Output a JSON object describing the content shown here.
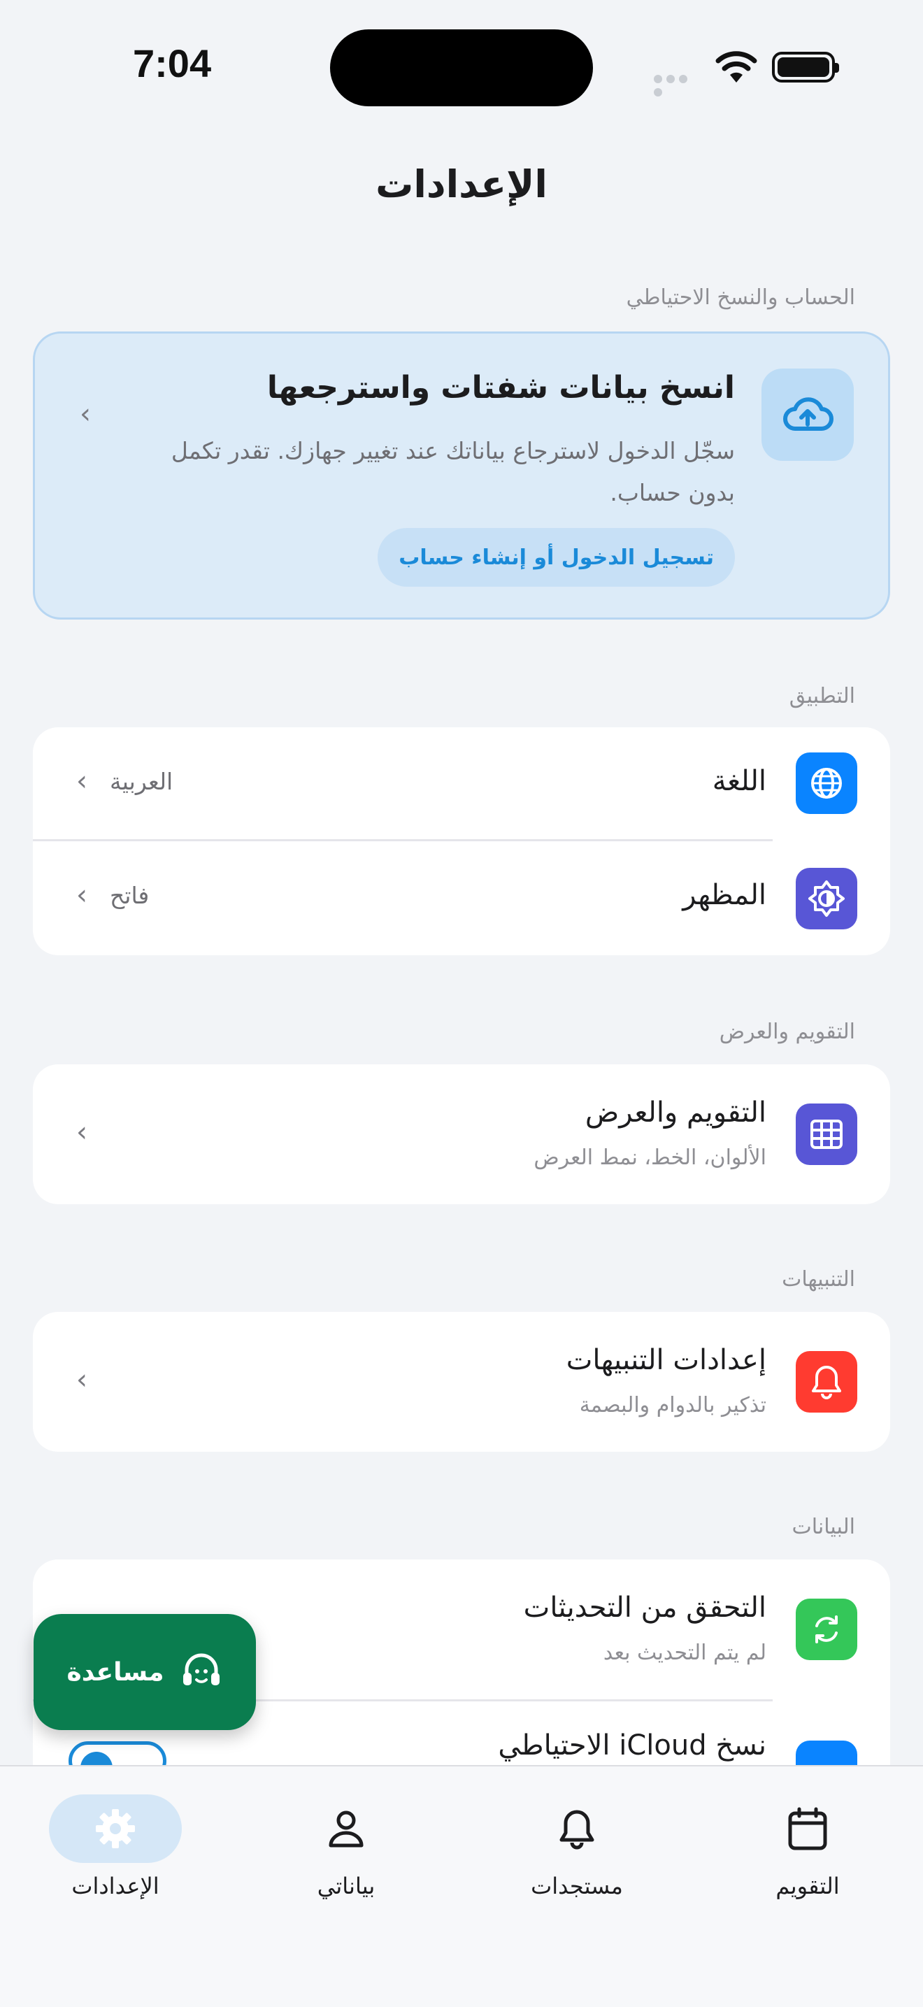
{
  "status_bar": {
    "time": "7:04"
  },
  "page": {
    "title": "الإعدادات"
  },
  "sections": {
    "account": "الحساب والنسخ الاحتياطي",
    "app": "التطبيق",
    "calendar": "التقويم والعرض",
    "notifications": "التنبيهات",
    "data": "البيانات"
  },
  "backup_card": {
    "title": "انسخ بيانات شفتات واسترجعها",
    "description": "سجّل الدخول لاسترجاع بياناتك عند تغيير جهازك. تقدر تكمل بدون حساب.",
    "button_label": "تسجيل الدخول أو إنشاء حساب",
    "icon": "cloud-upload-icon"
  },
  "app_rows": {
    "language": {
      "title": "اللغة",
      "value": "العربية",
      "icon": "globe-icon",
      "color": "#0a84ff"
    },
    "appearance": {
      "title": "المظهر",
      "value": "فاتح",
      "icon": "appearance-icon",
      "color": "#5856d6"
    }
  },
  "calendar_row": {
    "title": "التقويم والعرض",
    "subtitle": "الألوان، الخط، نمط العرض",
    "icon": "grid-icon",
    "color": "#5856d6"
  },
  "notifications_row": {
    "title": "إعدادات التنبيهات",
    "subtitle": "تذكير بالدوام والبصمة",
    "icon": "bell-icon",
    "color": "#ff3b30"
  },
  "data_rows": {
    "updates": {
      "title": "التحقق من التحديثات",
      "subtitle": "لم يتم التحديث بعد",
      "icon": "refresh-icon",
      "color": "#34c759"
    },
    "icloud": {
      "title": "نسخ iCloud الاحتياطي",
      "icon": "icloud-icon",
      "color": "#0a84ff",
      "toggle_on": true
    }
  },
  "help_button": {
    "label": "مساعدة",
    "color": "#0a7d4f"
  },
  "tab_bar": {
    "settings": "الإعدادات",
    "my_data": "بياناتي",
    "new": "مستجدات",
    "calendar": "التقويم",
    "active_tab": "settings"
  }
}
